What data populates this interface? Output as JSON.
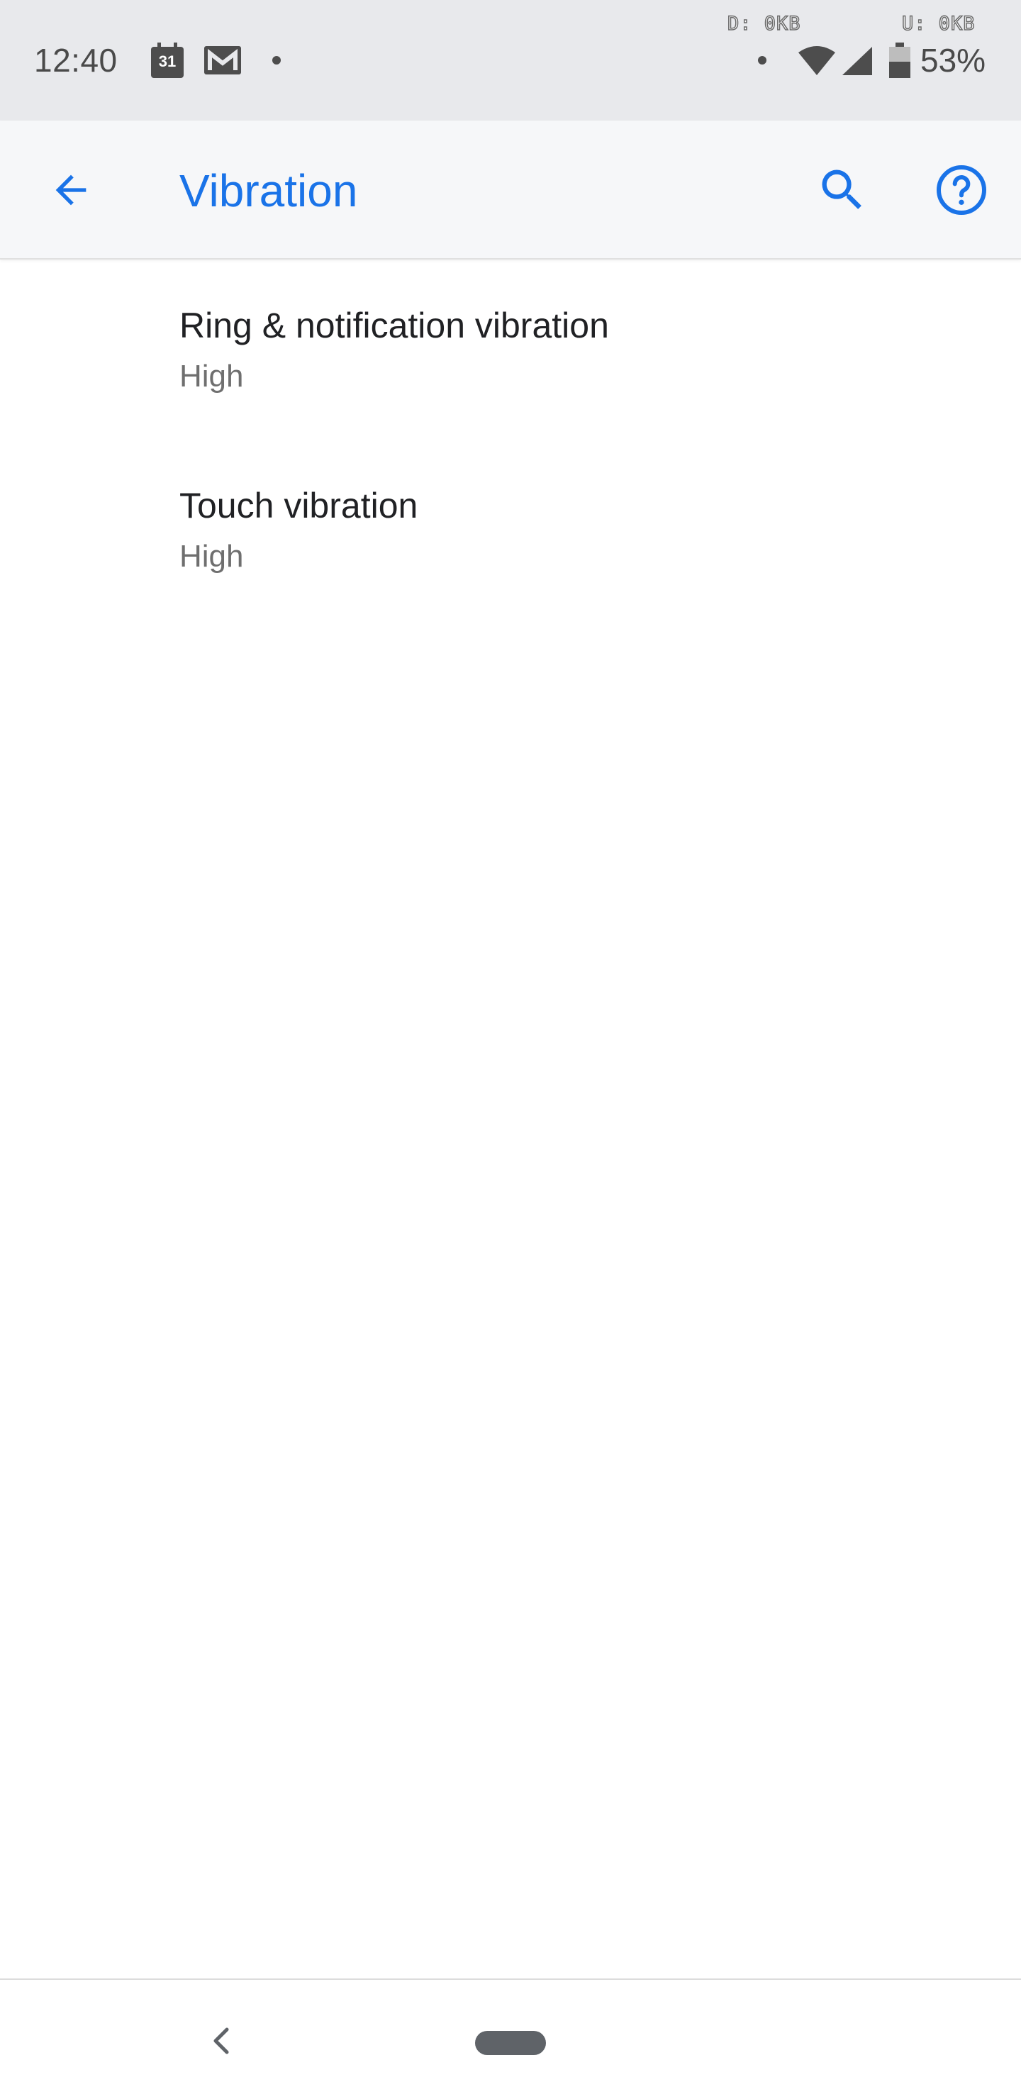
{
  "status_bar": {
    "time": "12:40",
    "calendar_day": "31",
    "net_down": "D: 0KB",
    "net_up": "U: 0KB",
    "battery_percent_label": "53%",
    "battery_level": 0.53,
    "icons": [
      "calendar-icon",
      "gmail-icon",
      "notification-dot",
      "wifi-icon",
      "signal-icon",
      "battery-icon"
    ]
  },
  "app_bar": {
    "title": "Vibration",
    "back_icon": "arrow-back-icon",
    "search_icon": "search-icon",
    "help_icon": "help-icon",
    "accent_color": "#1a73e8"
  },
  "settings": {
    "items": [
      {
        "title": "Ring & notification vibration",
        "summary": "High"
      },
      {
        "title": "Touch vibration",
        "summary": "High"
      }
    ]
  },
  "nav_bar": {
    "back_icon": "nav-back-icon",
    "home_icon": "home-pill"
  }
}
